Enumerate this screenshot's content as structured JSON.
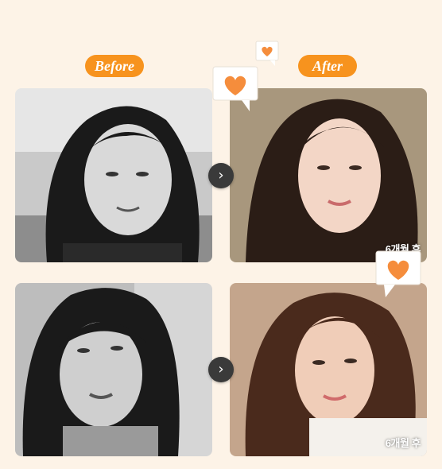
{
  "labels": {
    "before": "Before",
    "after": "After"
  },
  "captions": {
    "top_after": "6개월 후",
    "bottom_after": "6개월 후"
  },
  "icons": {
    "arrow": "›",
    "heart": "heart-icon"
  },
  "colors": {
    "accent": "#f7931e",
    "heart": "#f58d3c",
    "background": "#fdf3e7"
  }
}
